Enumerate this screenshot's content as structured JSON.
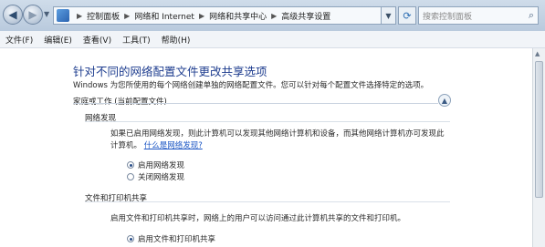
{
  "address": {
    "crumbs": [
      "控制面板",
      "网络和 Internet",
      "网络和共享中心",
      "高级共享设置"
    ],
    "search_placeholder": "搜索控制面板"
  },
  "menu": [
    "文件(F)",
    "编辑(E)",
    "查看(V)",
    "工具(T)",
    "帮助(H)"
  ],
  "page": {
    "title": "针对不同的网络配置文件更改共享选项",
    "description": "Windows 为您所使用的每个网络创建单独的网络配置文件。您可以针对每个配置文件选择特定的选项。",
    "profile_header": "家庭或工作 (当前配置文件)"
  },
  "network_discovery": {
    "heading": "网络发现",
    "text_line1": "如果已启用网络发现，则此计算机可以发现其他网络计算机和设备，而其他网络计算机亦可发现此",
    "text_line2": "计算机。",
    "link": "什么是网络发现?",
    "options": [
      "启用网络发现",
      "关闭网络发现"
    ]
  },
  "file_printer": {
    "heading": "文件和打印机共享",
    "text": "启用文件和打印机共享时，网络上的用户可以访问通过此计算机共享的文件和打印机。",
    "options": [
      "启用文件和打印机共享"
    ]
  },
  "colors": {
    "title": "#1e3d8f",
    "link": "#1a55c4"
  }
}
